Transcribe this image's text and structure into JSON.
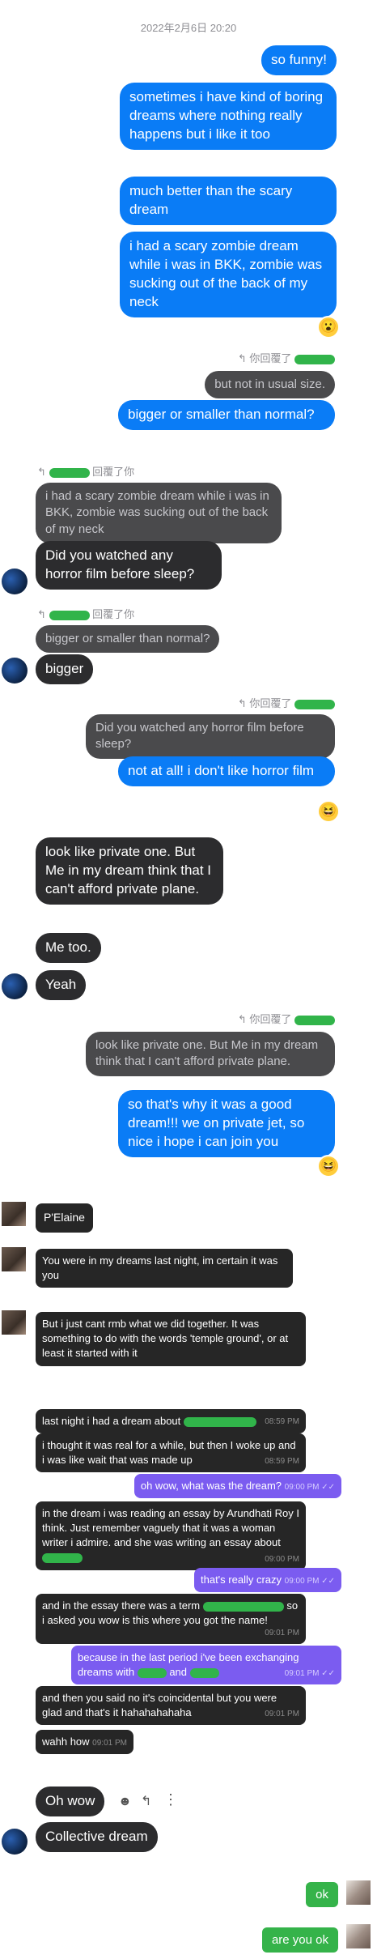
{
  "timestamp": "2022年2月6日 20:20",
  "you_replied": "你回覆了",
  "replied_to_you": "回覆了你",
  "msgs": {
    "m1": "so funny!",
    "m2": "sometimes i have kind of boring dreams where nothing really happens but i like it too",
    "m3": "much better than the scary dream",
    "m4": "i had a scary zombie dream while i was in BKK, zombie was sucking out of the back of my neck",
    "q5": "but not in usual size.",
    "m5": "bigger or smaller than normal?",
    "q6": "i had a scary zombie dream while i was in BKK, zombie was sucking out of the back of my neck",
    "m6": "Did you watched any horror film before sleep?",
    "q7": "bigger or smaller than normal?",
    "m7": "bigger",
    "q8": "Did you watched any horror film before sleep?",
    "m8": "not at all! i don't like horror film",
    "m9": "look like private one. But Me in my dream think that I can't afford private plane.",
    "m10": "Me too.",
    "m11": "Yeah",
    "q12": "look like private one. But Me in my dream think that I can't afford private plane.",
    "m12": "so that's why it was a good dream!!! we on private jet, so nice i hope i can join you"
  },
  "wa": {
    "name": "P'Elaine",
    "w1": "You were in my dreams last night, im certain it was you",
    "w2": "But i just cant rmb what we did together. It was something to do with the words 'temple ground', or at least it started with it",
    "c1": "last night i had a dream about",
    "t1": "08:59 PM",
    "c2": "i thought it was real for a while, but then I woke up and i was like wait that was made up",
    "t2": "08:59 PM",
    "c3": "oh wow, what was the dream?",
    "t3": "09:00 PM",
    "c4": "in the dream i was reading an essay by Arundhati Roy I think. Just remember vaguely that it was a woman writer i admire. and she was writing an essay about",
    "t4": "09:00 PM",
    "c5": "that's really crazy",
    "t5": "09:00 PM",
    "c6a": "and in the essay there was a term",
    "c6b": "so i asked you wow is this where you got the name!",
    "t6": "09:01 PM",
    "c7a": "because in the last period i've been exchanging dreams with",
    "c7b": "and",
    "t7": "09:01 PM",
    "c8": "and then you said no it's coincidental but you were glad and that's it hahahahahaha",
    "t8": "09:01 PM",
    "c9": "wahh how",
    "t9": "09:01 PM"
  },
  "end": {
    "e1": "Oh wow",
    "e2": "Collective dream",
    "g1": "ok",
    "g2": "are you ok"
  }
}
